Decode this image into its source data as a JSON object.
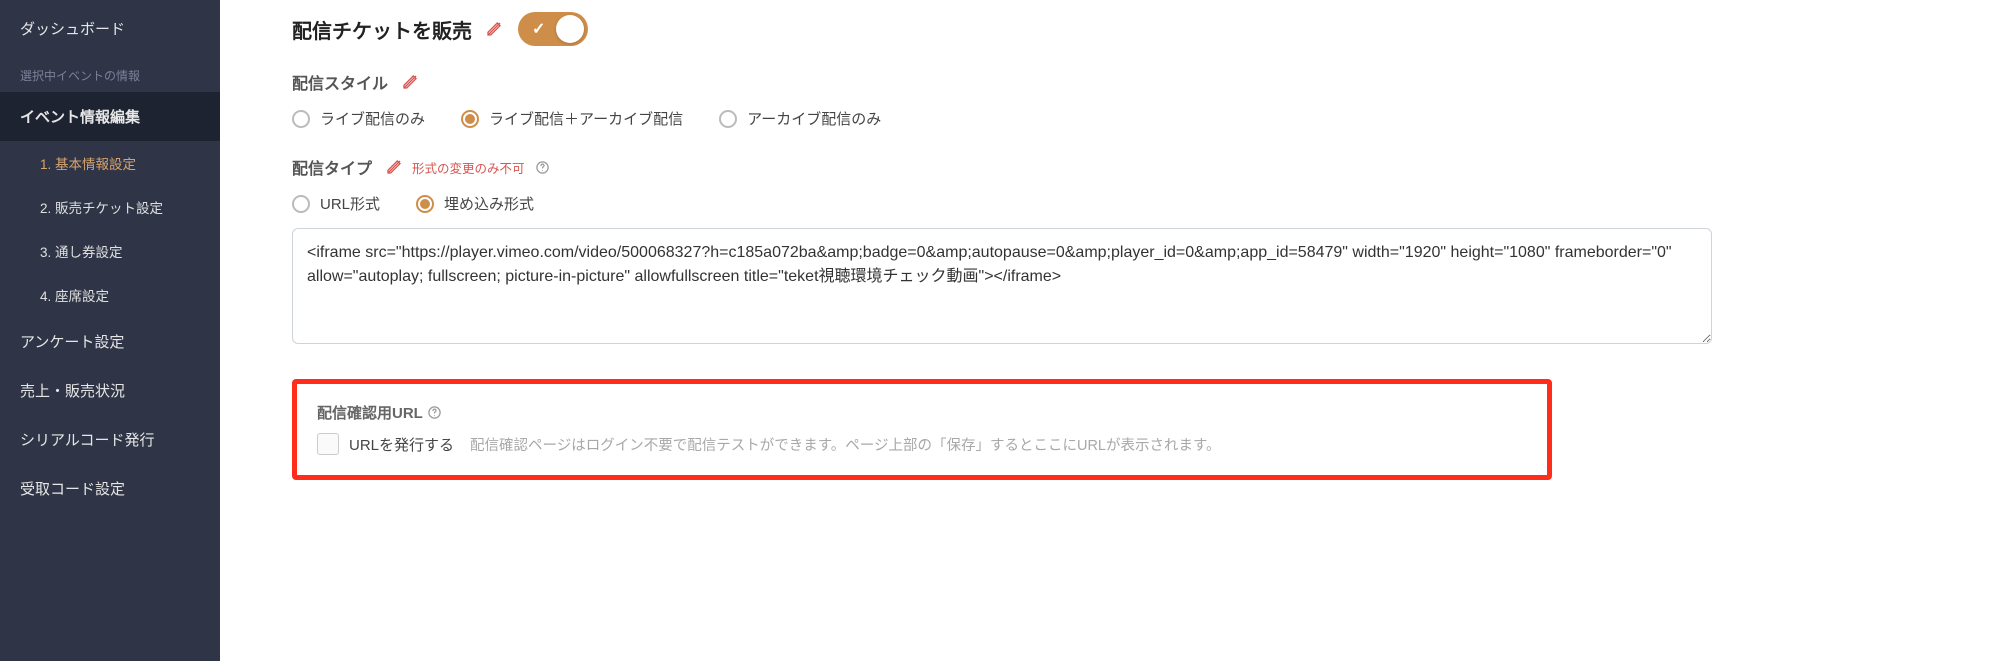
{
  "sidebar": {
    "dashboard": "ダッシュボード",
    "section_label": "選択中イベントの情報",
    "event_edit": "イベント情報編集",
    "subs": [
      {
        "label": "1. 基本情報設定"
      },
      {
        "label": "2. 販売チケット設定"
      },
      {
        "label": "3. 通し券設定"
      },
      {
        "label": "4. 座席設定"
      }
    ],
    "survey": "アンケート設定",
    "sales": "売上・販売状況",
    "serial": "シリアルコード発行",
    "receipt": "受取コード設定"
  },
  "main": {
    "sell_ticket_title": "配信チケットを販売",
    "style_label": "配信スタイル",
    "style_options": {
      "live_only": "ライブ配信のみ",
      "live_archive": "ライブ配信＋アーカイブ配信",
      "archive_only": "アーカイブ配信のみ"
    },
    "type_label": "配信タイプ",
    "type_note": "形式の変更のみ不可",
    "type_options": {
      "url": "URL形式",
      "embed": "埋め込み形式"
    },
    "embed_code": "<iframe src=\"https://player.vimeo.com/video/500068327?h=c185a072ba&amp;badge=0&amp;autopause=0&amp;player_id=0&amp;app_id=58479\" width=\"1920\" height=\"1080\" frameborder=\"0\" allow=\"autoplay; fullscreen; picture-in-picture\" allowfullscreen title=\"teket視聴環境チェック動画\"></iframe>",
    "confirm_url_label": "配信確認用URL",
    "issue_url_label": "URLを発行する",
    "issue_url_desc": "配信確認ページはログイン不要で配信テストができます。ページ上部の「保存」するとここにURLが表示されます。"
  }
}
